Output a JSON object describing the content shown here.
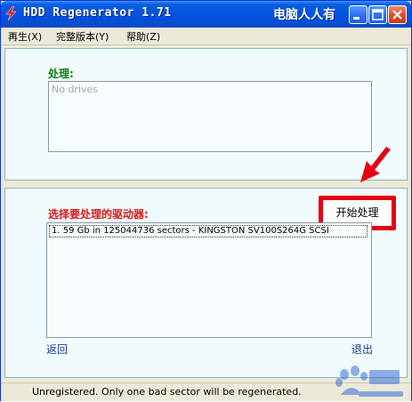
{
  "window": {
    "title": "HDD Regenerator 1.71",
    "title_extra": "电脑人人有"
  },
  "menu": {
    "items": [
      {
        "label": "再生(X)"
      },
      {
        "label": "完整版本(Y)"
      },
      {
        "label": "帮助(Z)"
      }
    ]
  },
  "process_panel": {
    "label": "处理:",
    "drives_placeholder": "No drives"
  },
  "select_panel": {
    "label": "选择要处理的驱动器:",
    "start_button": "开始处理",
    "drives": [
      {
        "text": "1. 59 Gb in 125044736 sectors  -  KINGSTON  SV100S264G SCSI"
      }
    ],
    "back_link": "返回",
    "exit_link": "退出"
  },
  "status": {
    "text": "Unregistered. Only one bad sector will be regenerated."
  },
  "colors": {
    "highlight": "#e60012",
    "process_label": "#0b7d10",
    "select_label": "#d61a1a",
    "titlebar": "#0554e3"
  },
  "icons": {
    "app": "red-lightning-icon",
    "minimize": "minimize-icon",
    "maximize": "maximize-icon",
    "close": "close-icon",
    "annotation": "red-arrow-icon"
  }
}
